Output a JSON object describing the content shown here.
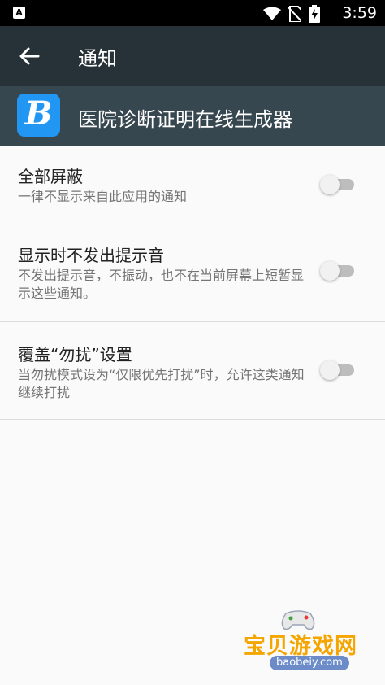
{
  "status_bar": {
    "time": "3:59",
    "left_badge": "A",
    "icons": [
      "wifi-icon",
      "no-sim-icon",
      "battery-charging-icon"
    ]
  },
  "app_bar": {
    "title": "通知"
  },
  "app_header": {
    "icon_letter": "B",
    "icon_color": "#2196f3",
    "app_name": "医院诊断证明在线生成器"
  },
  "settings": [
    {
      "title": "全部屏蔽",
      "subtitle": "一律不显示来自此应用的通知",
      "enabled": false
    },
    {
      "title": "显示时不发出提示音",
      "subtitle": "不发出提示音，不振动，也不在当前屏幕上短暂显示这些通知。",
      "enabled": false
    },
    {
      "title": "覆盖“勿扰”设置",
      "subtitle": "当勿扰模式设为“仅限优先打扰”时，允许这类通知继续打扰",
      "enabled": false
    }
  ],
  "watermark": {
    "text": "宝贝游戏网",
    "url": "baobeiy.com"
  },
  "colors": {
    "app_bar": "#263238",
    "app_header": "#37474f",
    "background": "#fafafa"
  }
}
